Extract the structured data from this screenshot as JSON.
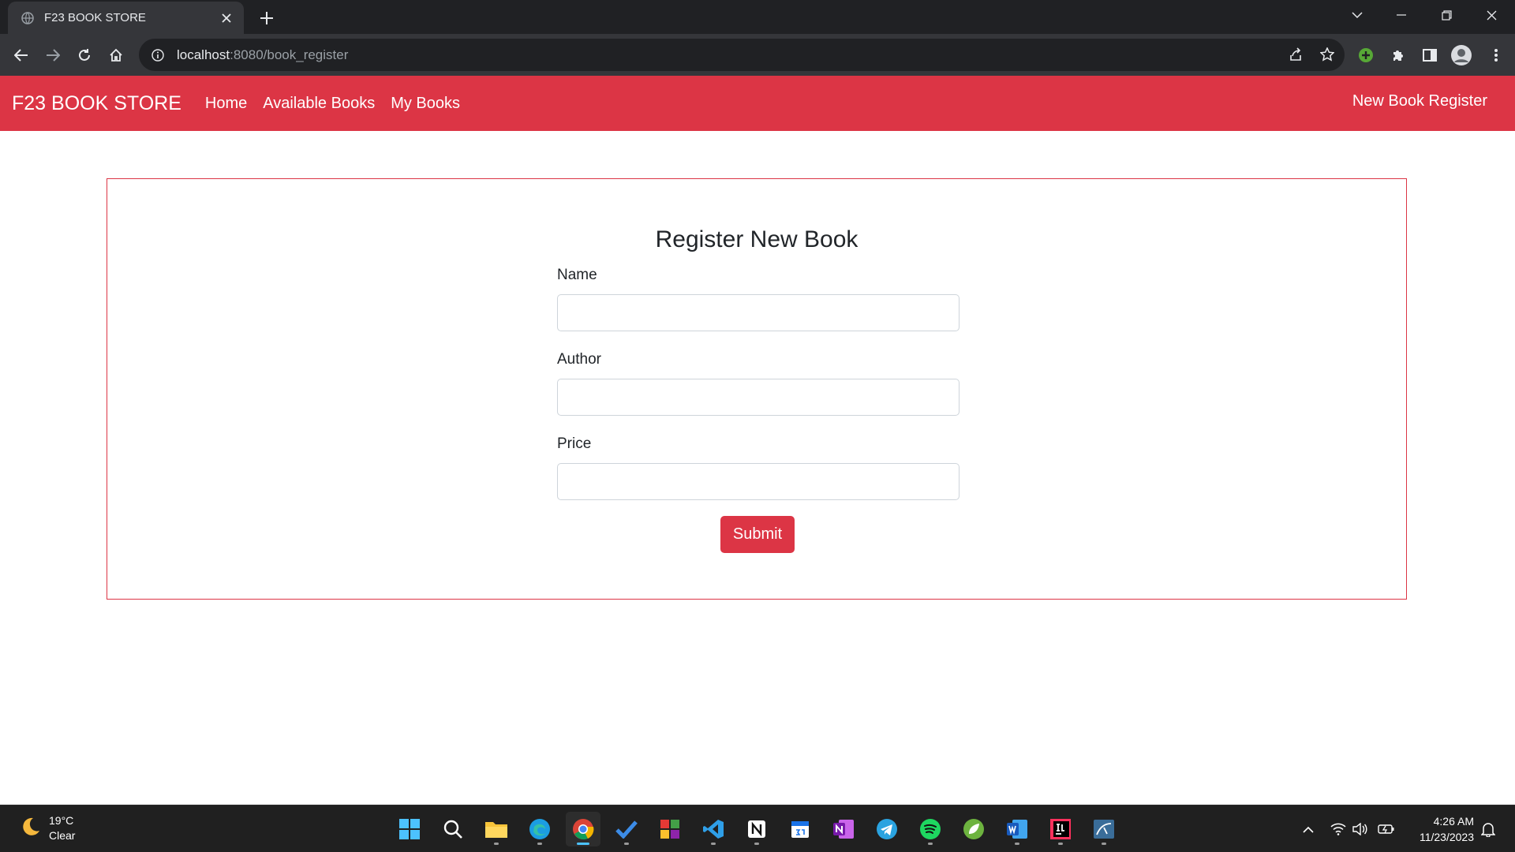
{
  "browser": {
    "tab_title": "F23 BOOK STORE",
    "url_host": "localhost",
    "url_rest": ":8080/book_register"
  },
  "navbar": {
    "brand": "F23 BOOK STORE",
    "links": [
      "Home",
      "Available Books",
      "My Books"
    ],
    "right_link": "New Book Register",
    "color": "#dc3545"
  },
  "form": {
    "title": "Register New Book",
    "fields": [
      {
        "label": "Name",
        "value": ""
      },
      {
        "label": "Author",
        "value": ""
      },
      {
        "label": "Price",
        "value": ""
      }
    ],
    "submit_label": "Submit"
  },
  "taskbar": {
    "weather_temp": "19°C",
    "weather_desc": "Clear",
    "time": "4:26 AM",
    "date": "11/23/2023",
    "apps": [
      "start-icon",
      "search-icon",
      "file-explorer-icon",
      "edge-icon",
      "chrome-icon",
      "todo-icon",
      "app-icon",
      "vscode-icon",
      "notion-icon",
      "calendar-icon",
      "onenote-icon",
      "telegram-icon",
      "spotify-icon",
      "spring-icon",
      "word-icon",
      "intellij-icon",
      "mysql-workbench-icon"
    ]
  }
}
